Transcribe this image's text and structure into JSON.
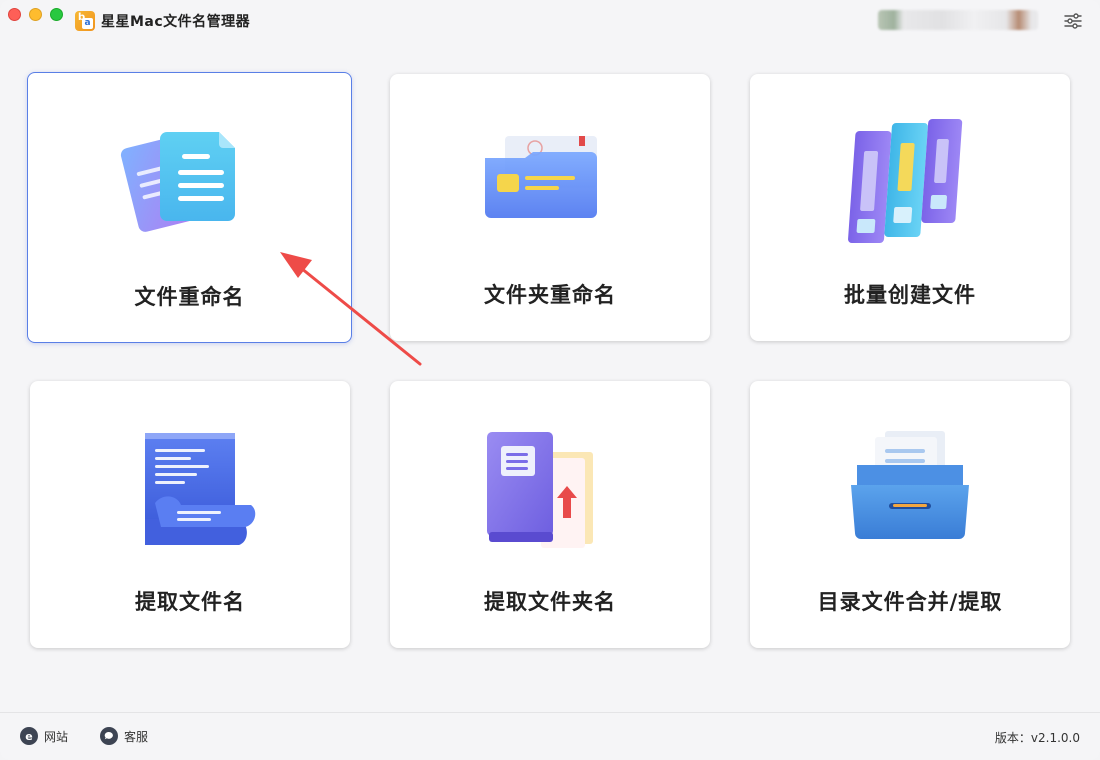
{
  "app": {
    "title": "星星Mac文件名管理器",
    "logo_glyph": "b",
    "logo_sub": "a"
  },
  "titlebar": {
    "icons": [
      "close-button",
      "minimize-button",
      "maximize-button",
      "settings-sliders-icon"
    ]
  },
  "cards": [
    {
      "label": "文件重命名",
      "icon": "documents-icon",
      "selected": true
    },
    {
      "label": "文件夹重命名",
      "icon": "folder-icon",
      "selected": false
    },
    {
      "label": "批量创建文件",
      "icon": "binders-icon",
      "selected": false
    },
    {
      "label": "提取文件名",
      "icon": "scroll-document-icon",
      "selected": false
    },
    {
      "label": "提取文件夹名",
      "icon": "book-folder-icon",
      "selected": false
    },
    {
      "label": "目录文件合并/提取",
      "icon": "file-drawer-icon",
      "selected": false
    }
  ],
  "footer": {
    "website_label": "网站",
    "website_glyph": "e",
    "support_label": "客服",
    "version_text": "版本：v2.1.0.0"
  },
  "colors": {
    "accent": "#5a7fe6",
    "annotation_arrow": "#ee4b48"
  }
}
